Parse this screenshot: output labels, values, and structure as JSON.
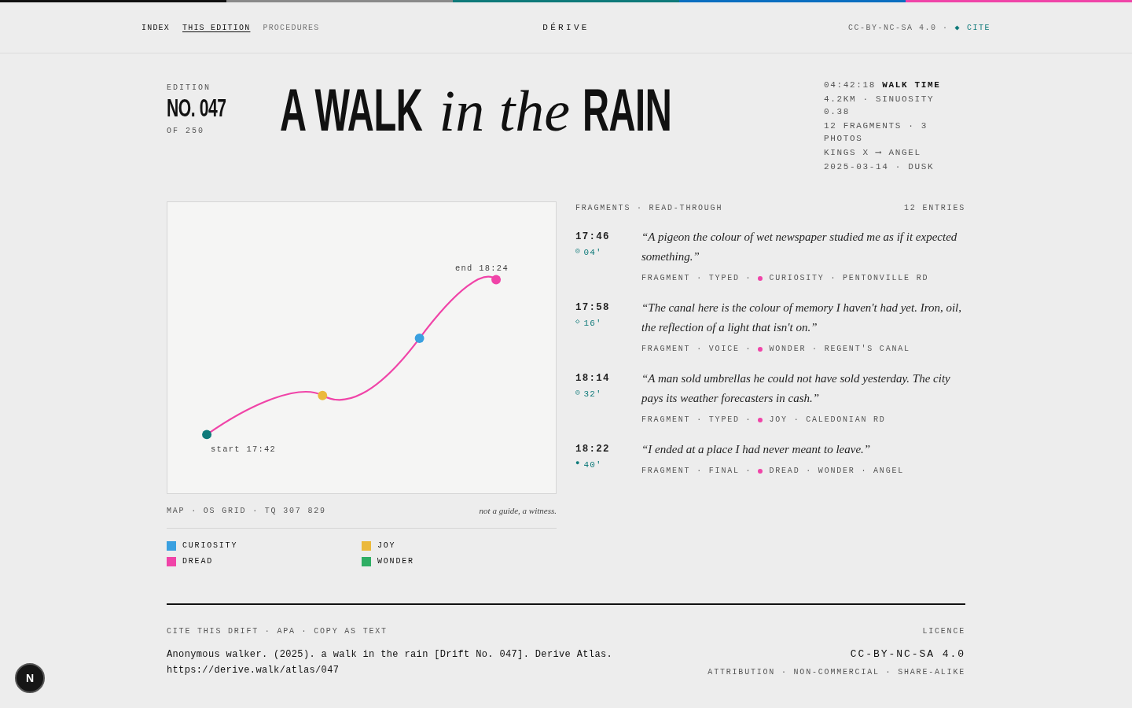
{
  "nav": {
    "links": [
      {
        "label": "INDEX",
        "selected": false,
        "muted": false
      },
      {
        "label": "THIS EDITION",
        "selected": true,
        "muted": false
      },
      {
        "label": "PROCEDURES",
        "selected": false,
        "muted": true
      }
    ],
    "brand": "DÉRIVE",
    "licence": "CC-BY-NC-SA 4.0 ·",
    "cite_icon": "◆",
    "cite": "CITE"
  },
  "edition": {
    "label": "EDITION",
    "number": "NO. 047",
    "of": "OF 250"
  },
  "title": [
    {
      "text": "A WALK",
      "kind": "display"
    },
    {
      "text": "in the",
      "kind": "italic"
    },
    {
      "text": "RAIN",
      "kind": "display"
    }
  ],
  "stats": [
    "04:42:18 **WALK TIME**",
    "4.2KM · SINUOSITY 0.38",
    "12 FRAGMENTS · 3 PHOTOS",
    "KINGS X ⟶ ANGEL",
    "2025-03-14 · DUSK"
  ],
  "map": {
    "markers": [
      {
        "color": "#0f7a7a"
      },
      {
        "color": "#ebb93c"
      },
      {
        "color": "#3aa0e0"
      },
      {
        "color": "#f044a8"
      }
    ],
    "start_label": "start 17:42",
    "end_label": "end 18:24",
    "caption": "MAP · OS GRID · TQ 307 829",
    "motto": "not a guide, a witness."
  },
  "legend": [
    {
      "label": "CURIOSITY",
      "color": "#3aa0e0"
    },
    {
      "label": "JOY",
      "color": "#ebb93c"
    },
    {
      "label": "DREAD",
      "color": "#f044a8"
    },
    {
      "label": "WONDER",
      "color": "#2fae64"
    }
  ],
  "fragments": {
    "heading": "FRAGMENTS · READ-THROUGH",
    "count": "12 ENTRIES",
    "entries": [
      {
        "time": "17:46",
        "icon": "◎",
        "offset": "04'",
        "quote": "“A pigeon the colour of wet newspaper studied me as if it expected something.”",
        "meta": "FRAGMENT · TYPED ·",
        "color": "#f044a8",
        "tags": "CURIOSITY · PENTONVILLE RD"
      },
      {
        "time": "17:58",
        "icon": "◇",
        "offset": "16'",
        "quote": "“The canal here is the colour of memory I haven't had yet. Iron, oil, the reflection of a light that isn't on.”",
        "meta": "FRAGMENT · VOICE ·",
        "color": "#f044a8",
        "tags": "WONDER · REGENT'S CANAL"
      },
      {
        "time": "18:14",
        "icon": "◎",
        "offset": "32'",
        "quote": "“A man sold umbrellas he could not have sold yesterday. The city pays its weather forecasters in cash.”",
        "meta": "FRAGMENT · TYPED ·",
        "color": "#f044a8",
        "tags": "JOY · CALEDONIAN RD"
      },
      {
        "time": "18:22",
        "icon": "●",
        "offset": "40'",
        "quote": "“I ended at a place I had never meant to leave.”",
        "meta": "FRAGMENT · FINAL ·",
        "color": "#f044a8",
        "tags": "DREAD · WONDER · ANGEL"
      }
    ]
  },
  "footer": {
    "cite_heading": "CITE THIS DRIFT · APA · COPY AS TEXT",
    "citation": "Anonymous walker. (2025). a walk in the rain [Drift No. 047]. Derive Atlas.",
    "url": "https://derive.walk/atlas/047",
    "licence_heading": "LICENCE",
    "licence": "CC-BY-NC-SA 4.0",
    "licence_terms": "ATTRIBUTION · NON-COMMERCIAL · SHARE-ALIKE"
  },
  "dev_badge": "N"
}
